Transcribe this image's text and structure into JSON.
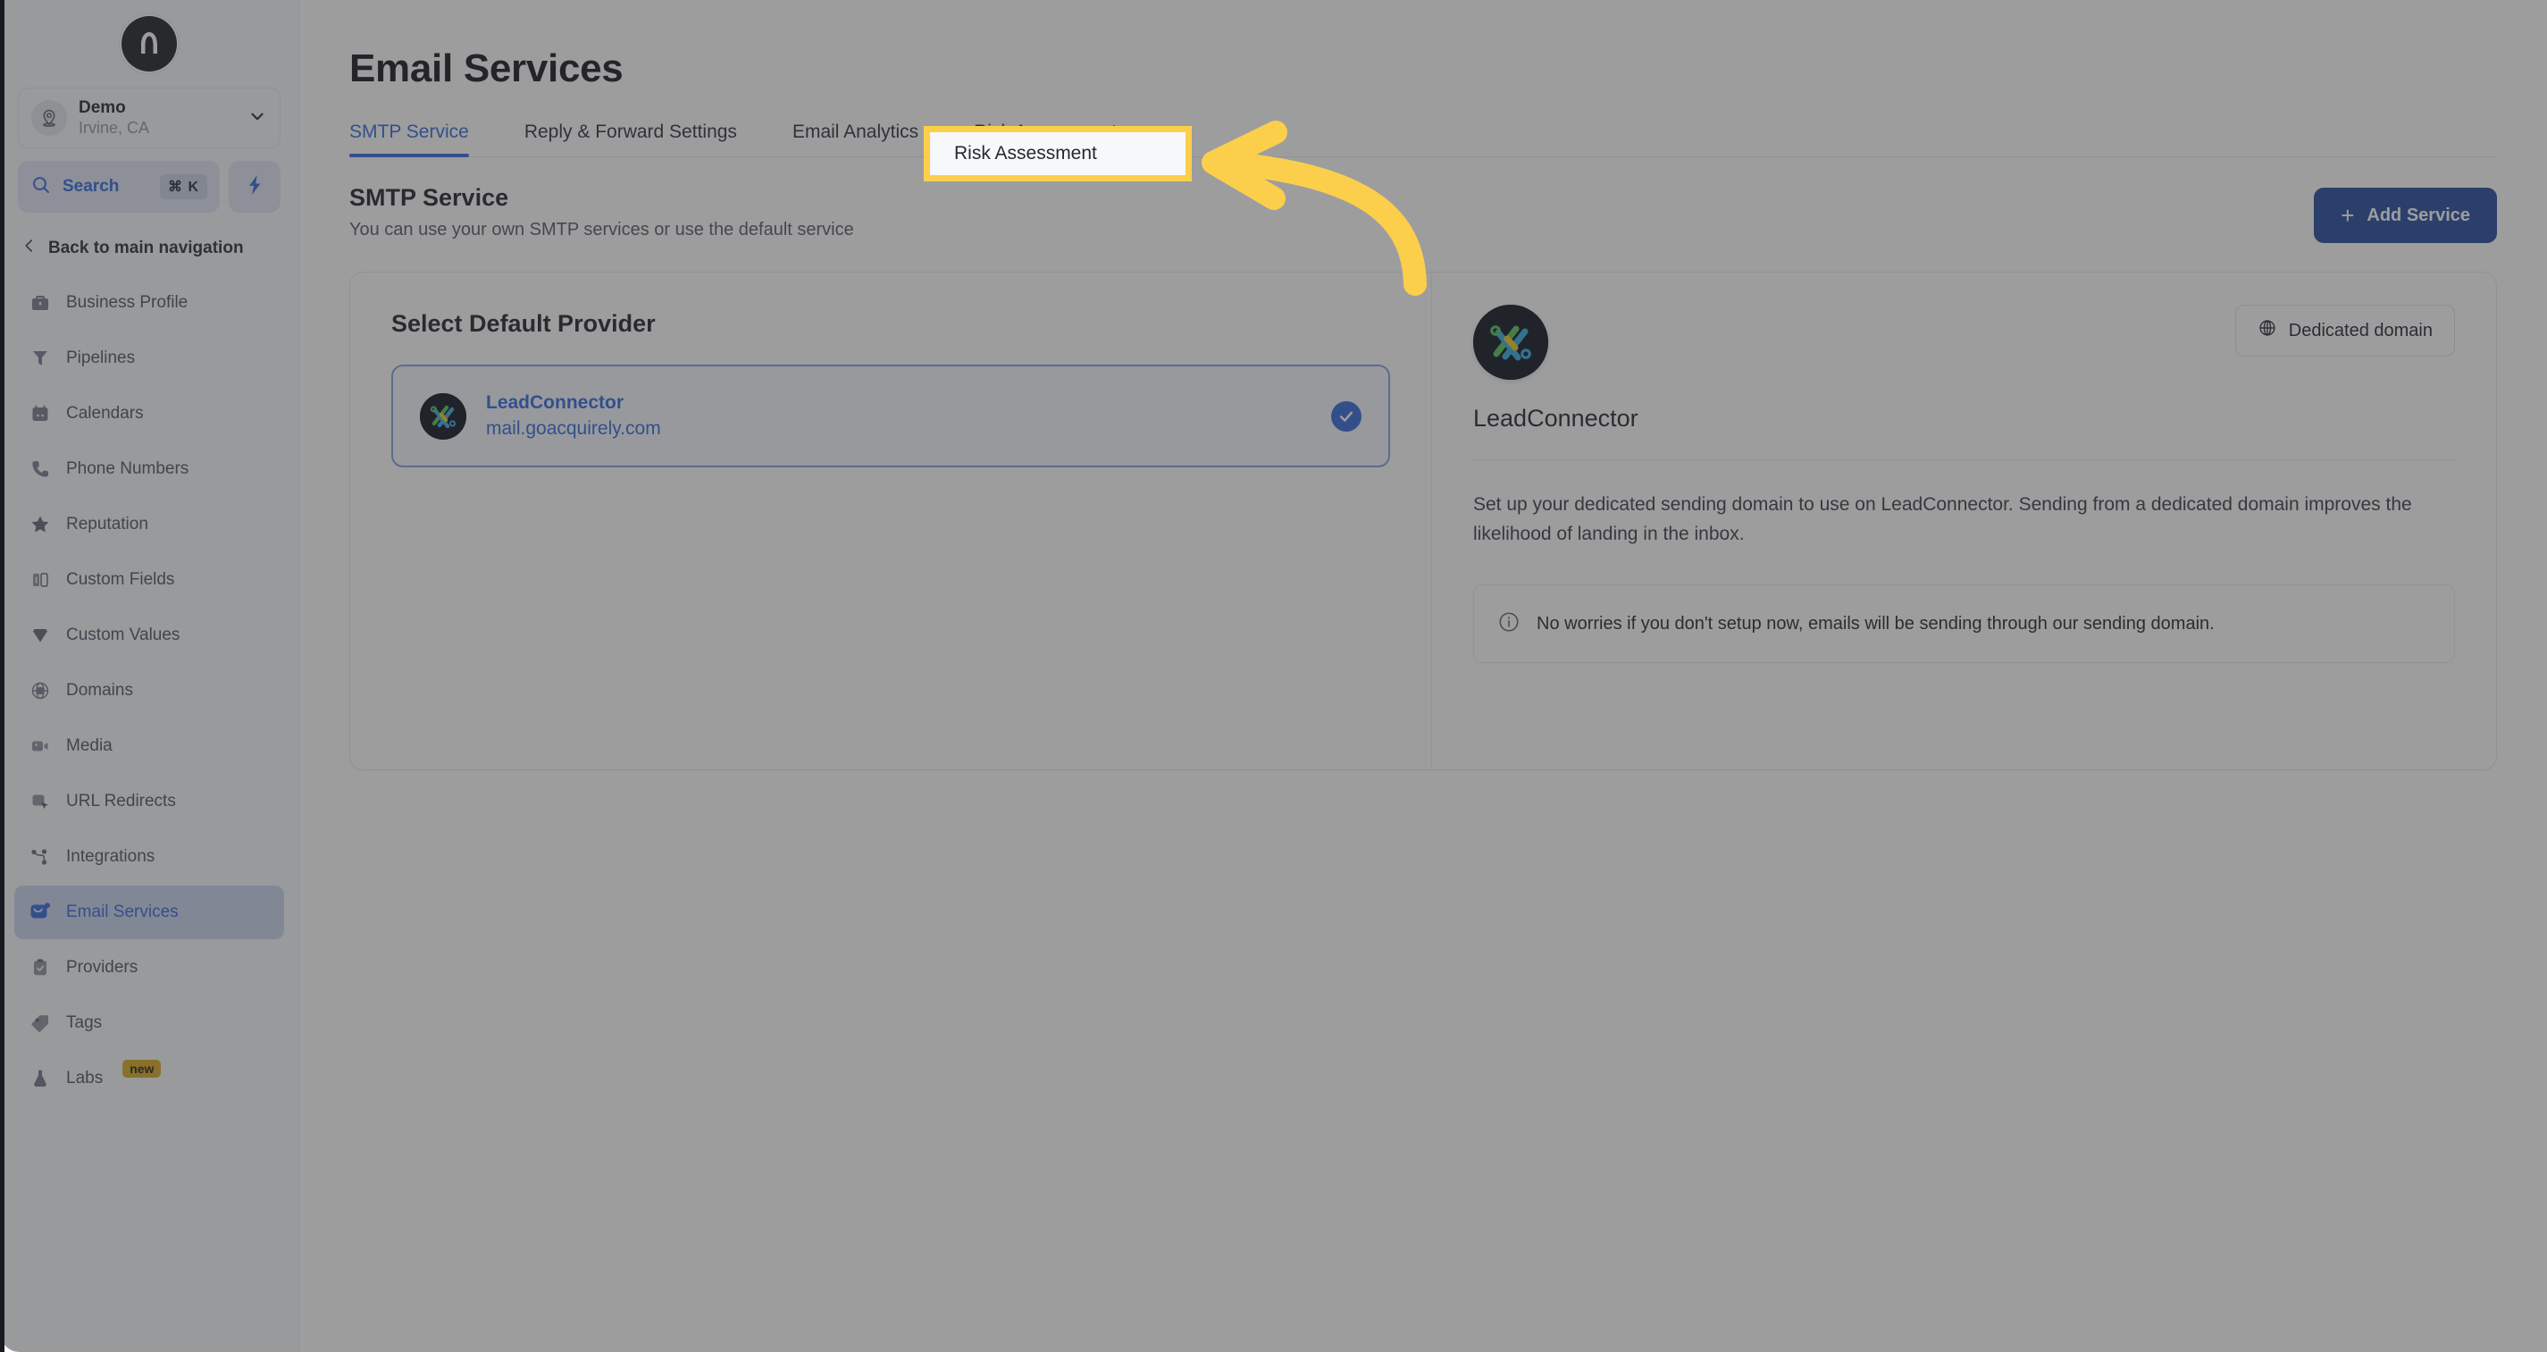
{
  "sidebar": {
    "logo_icon": "rocket-logo-icon",
    "account": {
      "name": "Demo",
      "location": "Irvine, CA",
      "avatar_icon": "location-pin-icon",
      "chevron_icon": "chevron-down-icon"
    },
    "search": {
      "label": "Search",
      "shortcut": "⌘ K",
      "icon": "search-icon"
    },
    "quick_action_icon": "lightning-bolt-icon",
    "back_nav": {
      "label": "Back to main navigation",
      "icon": "chevron-left-icon"
    },
    "items": [
      {
        "label": "Business Profile",
        "icon": "briefcase-icon",
        "active": false
      },
      {
        "label": "Pipelines",
        "icon": "funnel-icon",
        "active": false
      },
      {
        "label": "Calendars",
        "icon": "calendar-icon",
        "active": false
      },
      {
        "label": "Phone Numbers",
        "icon": "phone-icon",
        "active": false
      },
      {
        "label": "Reputation",
        "icon": "star-icon",
        "active": false
      },
      {
        "label": "Custom Fields",
        "icon": "columns-icon",
        "active": false
      },
      {
        "label": "Custom Values",
        "icon": "gem-icon",
        "active": false
      },
      {
        "label": "Domains",
        "icon": "globe-icon",
        "active": false
      },
      {
        "label": "Media",
        "icon": "video-camera-icon",
        "active": false
      },
      {
        "label": "URL Redirects",
        "icon": "cursor-click-icon",
        "active": false
      },
      {
        "label": "Integrations",
        "icon": "nodes-icon",
        "active": false
      },
      {
        "label": "Email Services",
        "icon": "envelope-icon",
        "active": true
      },
      {
        "label": "Providers",
        "icon": "clipboard-check-icon",
        "active": false
      },
      {
        "label": "Tags",
        "icon": "tag-icon",
        "active": false
      },
      {
        "label": "Labs",
        "icon": "flask-icon",
        "active": false,
        "badge": "new"
      }
    ]
  },
  "main": {
    "page_title": "Email Services",
    "tabs": [
      {
        "label": "SMTP Service",
        "active": true
      },
      {
        "label": "Reply & Forward Settings",
        "active": false
      },
      {
        "label": "Email Analytics",
        "active": false
      },
      {
        "label": "Risk Assessment",
        "active": false
      }
    ],
    "section": {
      "title": "SMTP Service",
      "subtitle": "You can use your own SMTP services or use the default service"
    },
    "add_service_button": {
      "label": "Add Service",
      "plus": "+",
      "icon": "plus-icon"
    },
    "card": {
      "select_provider_title": "Select Default Provider",
      "provider": {
        "name": "LeadConnector",
        "domain": "mail.goacquirely.com",
        "selected": true,
        "logo_icon": "leadconnector-logo-icon",
        "check_icon": "check-circle-icon"
      },
      "dedicated_domain_button": {
        "label": "Dedicated domain",
        "icon": "globe-icon"
      },
      "detail": {
        "provider_name": "LeadConnector",
        "logo_icon": "leadconnector-logo-icon",
        "description": "Set up your dedicated sending domain to use on LeadConnector. Sending from a dedicated domain improves the likelihood of landing in the inbox.",
        "info": {
          "icon": "info-circle-icon",
          "text": "No worries if you don't setup now, emails will be sending through our sending domain."
        }
      }
    }
  },
  "annotation": {
    "highlight_label": "Risk Assessment",
    "highlight_color": "#fbcf4c",
    "arrow_color": "#fbcf4c",
    "arrow_icon": "curved-arrow-left-icon"
  },
  "colors": {
    "accent_blue": "#2b62d9",
    "primary_button": "#1b4399",
    "highlight_yellow": "#fbcf4c",
    "badge_yellow": "#d6a619"
  }
}
